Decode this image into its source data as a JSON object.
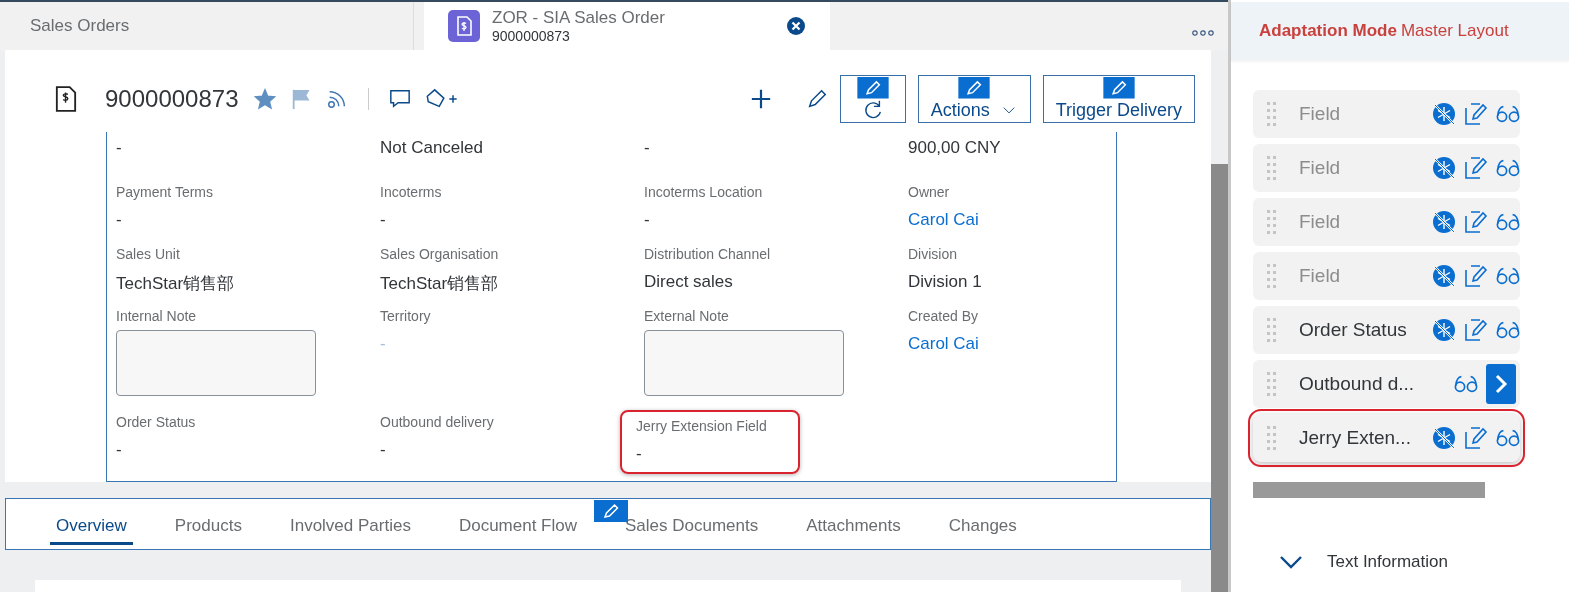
{
  "shell_tabs": [
    {
      "label": "Sales Orders",
      "selected": false
    },
    {
      "label": "ZOR - SIA Sales Order",
      "subtitle": "9000000873",
      "selected": true
    }
  ],
  "object_header": {
    "title": "9000000873",
    "favorite": true,
    "flagged": true,
    "buttons": [
      {
        "kind": "refresh"
      },
      {
        "kind": "menu",
        "label": "Actions"
      },
      {
        "kind": "text",
        "label": "Trigger Delivery"
      }
    ]
  },
  "form": [
    {
      "value": "-",
      "kind": "text"
    },
    {
      "value": "Not Canceled",
      "kind": "text"
    },
    {
      "value": "-",
      "kind": "text"
    },
    {
      "value": "900,00 CNY",
      "kind": "text"
    },
    {
      "label": "Payment Terms",
      "value": "-",
      "kind": "text"
    },
    {
      "label": "Incoterms",
      "value": "-",
      "kind": "text"
    },
    {
      "label": "Incoterms Location",
      "value": "-",
      "kind": "text"
    },
    {
      "label": "Owner",
      "value": "Carol Cai",
      "kind": "link"
    },
    {
      "label": "Sales Unit",
      "value": "TechStar销售部",
      "kind": "text"
    },
    {
      "label": "Sales Organisation",
      "value": "TechStar销售部",
      "kind": "text"
    },
    {
      "label": "Distribution Channel",
      "value": "Direct sales",
      "kind": "text"
    },
    {
      "label": "Division",
      "value": "Division 1",
      "kind": "text"
    },
    {
      "label": "Internal Note",
      "kind": "textarea"
    },
    {
      "label": "Territory",
      "value": "-",
      "kind": "muted"
    },
    {
      "label": "External Note",
      "kind": "textarea"
    },
    {
      "label": "Created By",
      "value": "Carol Cai",
      "kind": "link"
    },
    {
      "label": "Order Status",
      "value": "-",
      "kind": "text"
    },
    {
      "label": "Outbound delivery",
      "value": "-",
      "kind": "text"
    },
    {
      "label": "Jerry Extension Field",
      "value": "-",
      "kind": "text",
      "highlighted": true
    }
  ],
  "section_tabs": [
    {
      "label": "Overview",
      "selected": true
    },
    {
      "label": "Products",
      "selected": false
    },
    {
      "label": "Involved Parties",
      "selected": false
    },
    {
      "label": "Document Flow",
      "selected": false
    },
    {
      "label": "Sales Documents",
      "selected": false
    },
    {
      "label": "Attachments",
      "selected": false
    },
    {
      "label": "Changes",
      "selected": false
    }
  ],
  "adaptation": {
    "title": "Adaptation Mode",
    "subtitle": "Master Layout",
    "fields": [
      {
        "label": "Field",
        "kind": "field",
        "dimmed": true,
        "highlighted": false
      },
      {
        "label": "Field",
        "kind": "field",
        "dimmed": true,
        "highlighted": false
      },
      {
        "label": "Field",
        "kind": "field",
        "dimmed": true,
        "highlighted": false
      },
      {
        "label": "Field",
        "kind": "field",
        "dimmed": true,
        "highlighted": false
      },
      {
        "label": "Order Status",
        "kind": "field",
        "dimmed": false,
        "highlighted": false
      },
      {
        "label": "Outbound d...",
        "kind": "navigation",
        "dimmed": false,
        "highlighted": false
      },
      {
        "label": "Jerry Exten...",
        "kind": "field",
        "dimmed": false,
        "highlighted": true
      }
    ],
    "section": {
      "label": "Text Information",
      "expanded": true
    }
  }
}
